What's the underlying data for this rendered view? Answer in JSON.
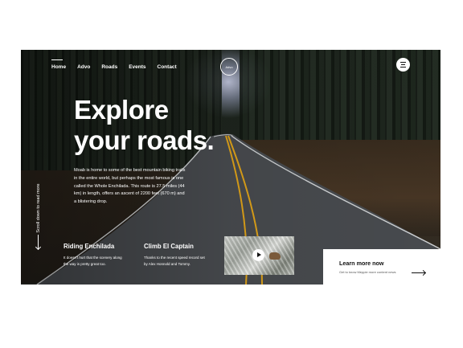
{
  "nav": {
    "items": [
      "Home",
      "Advo",
      "Roads",
      "Events",
      "Contact"
    ],
    "active": "Home"
  },
  "logo": {
    "text": "Advo"
  },
  "menu_icon": "hamburger-menu-icon",
  "hero": {
    "headline_line1": "Explore",
    "headline_line2": "your roads.",
    "description": "Moab is home to some of the best mountain biking trails in the entire world, but perhaps the most famous is one called the Whole Enchilada. This route is 27.5 miles (44 km) in length, offers an ascent of 2200 feet (670 m) and a blistering drop."
  },
  "scroll_hint": {
    "text": "Scroll down to read more",
    "icon": "arrow-down-icon"
  },
  "cards": [
    {
      "title": "Riding  Enchilada",
      "text": "It doesn't hurt that the scenery along the way is pretty great too."
    },
    {
      "title": "Climb El Captain",
      "text": "Thanks to the recent speed record set by Alex Honnold and Tommy."
    }
  ],
  "video": {
    "play_icon": "play-icon"
  },
  "learn_more": {
    "title": "Learn more now",
    "subtitle": "Get to know Meppie more content news",
    "icon": "arrow-right-icon"
  },
  "colors": {
    "white": "#ffffff",
    "dark": "#111111",
    "road_line": "#e8a91a"
  }
}
